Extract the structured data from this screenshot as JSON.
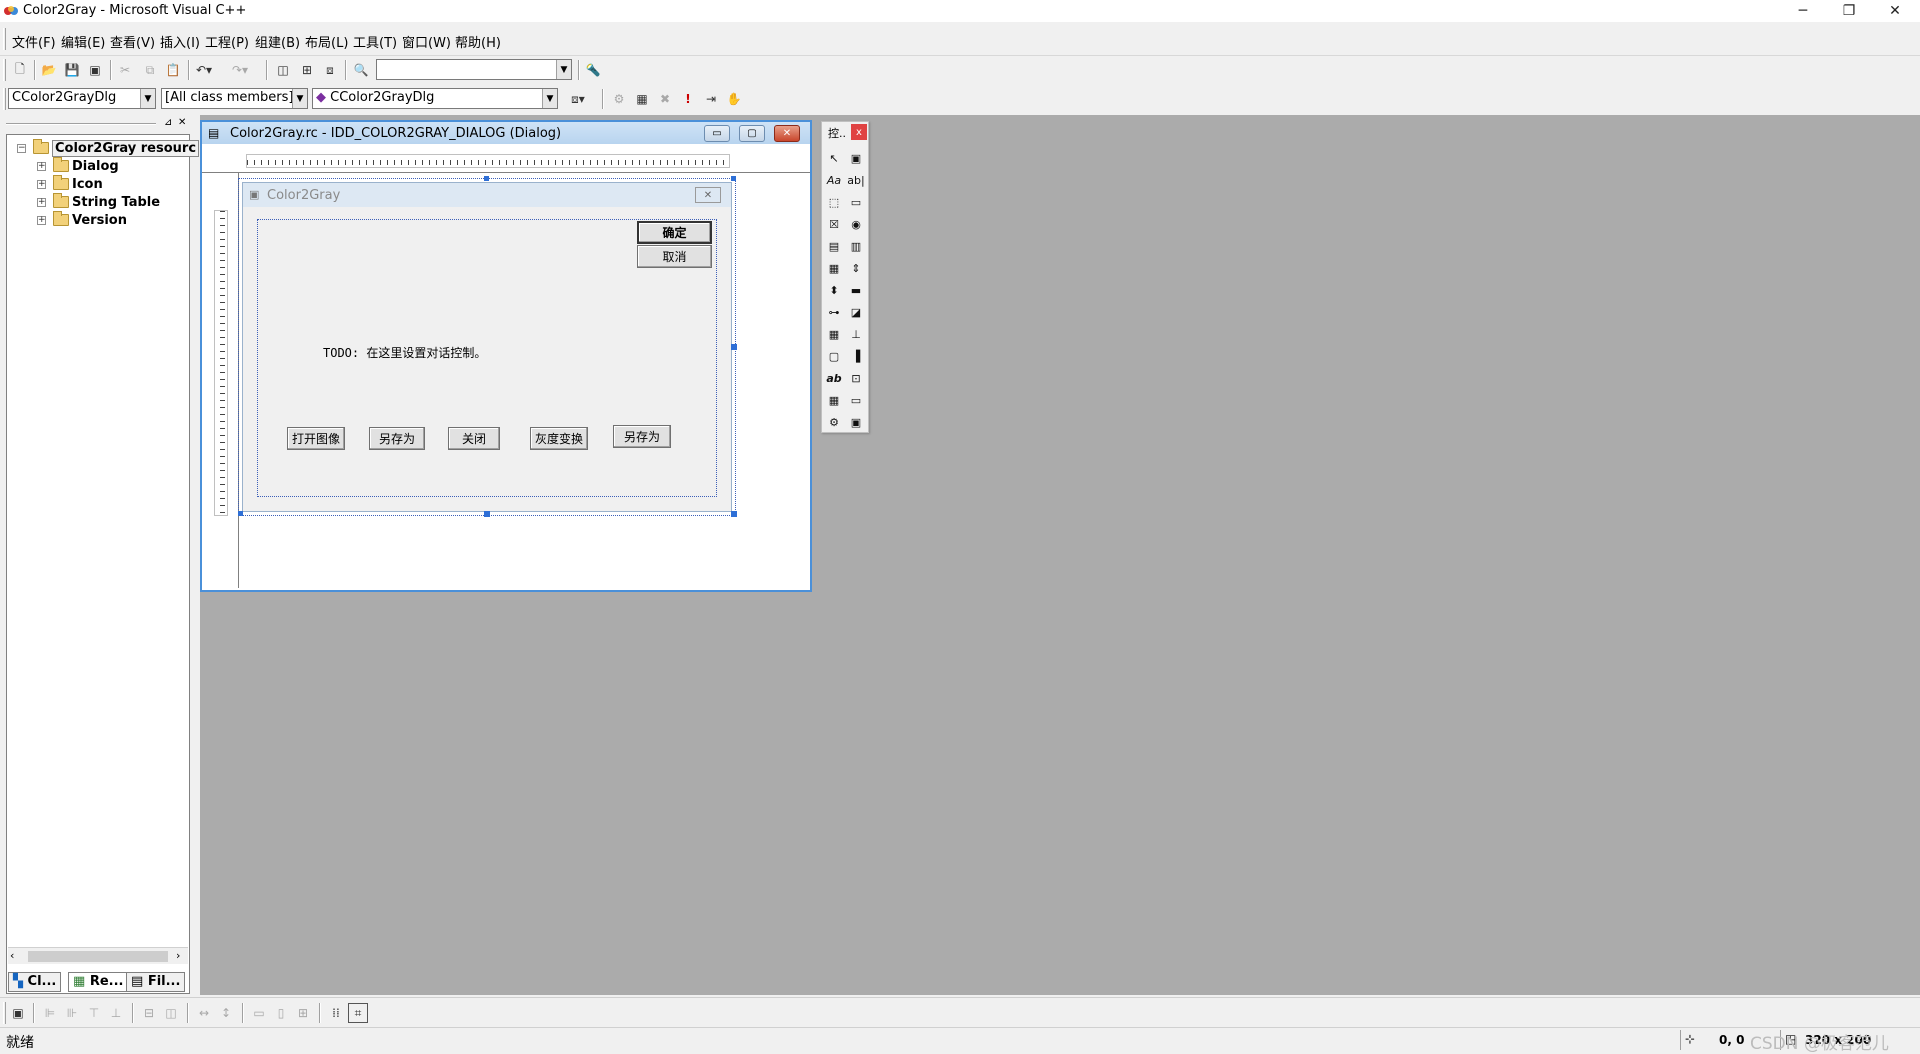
{
  "window": {
    "title": "Color2Gray - Microsoft Visual C++",
    "minimize": "─",
    "restore": "❐",
    "close": "✕"
  },
  "menu": [
    "文件(F)",
    "编辑(E)",
    "查看(V)",
    "插入(I)",
    "工程(P)",
    "组建(B)",
    "布局(L)",
    "工具(T)",
    "窗口(W)",
    "帮助(H)"
  ],
  "toolbar2": {
    "class_combo": "CColor2GrayDlg",
    "filter_combo": "[All class members]",
    "member_combo": "CColor2GrayDlg"
  },
  "left_panel": {
    "root": "Color2Gray resourc",
    "items": [
      "Dialog",
      "Icon",
      "String Table",
      "Version"
    ],
    "tabs": [
      "Cl...",
      "Re...",
      "Fil..."
    ]
  },
  "rc_window": {
    "title": "Color2Gray.rc - IDD_COLOR2GRAY_DIALOG (Dialog)",
    "btn_min": "▭",
    "btn_max": "▢",
    "btn_close": "✕"
  },
  "dialog": {
    "title": "Color2Gray",
    "close": "✕",
    "ok": "确定",
    "cancel": "取消",
    "todo": "TODO: 在这里设置对话控制。",
    "buttons": [
      "打开图像",
      "另存为",
      "关闭",
      "灰度变换",
      "另存为"
    ]
  },
  "palette": {
    "title": "控..",
    "close": "x",
    "icons": [
      "↖",
      "▣",
      "Aa",
      "ab|",
      "⬚",
      "▭",
      "☒",
      "◉",
      "▤",
      "▥",
      "▦",
      "⇕",
      "⬍",
      "▬",
      "⊶",
      "◪",
      "▦",
      "⊥",
      "▢",
      "▐",
      "ab",
      "⊡",
      "▦",
      "▭",
      "⚙",
      "▣"
    ]
  },
  "status": {
    "text": "就绪",
    "position": "0, 0",
    "size": "320 x 200",
    "overlay": "CSDN @极客范儿"
  }
}
